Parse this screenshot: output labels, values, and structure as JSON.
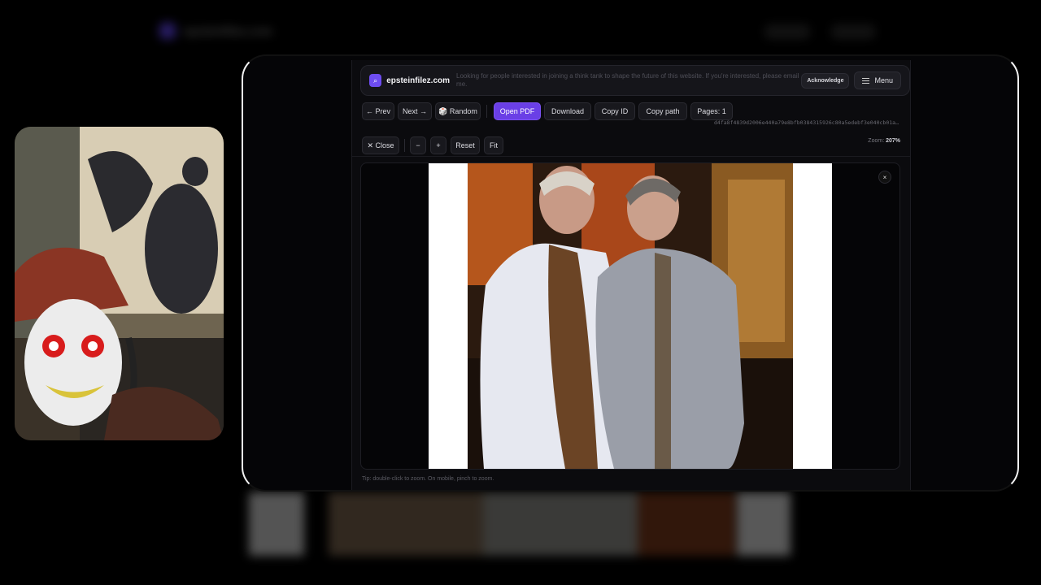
{
  "site": {
    "name": "epsteinfilez.com",
    "notice": "Looking for people interested in joining a think tank to shape the future of this website. If you're interested, please email me.",
    "acknowledge_label": "Acknowledge",
    "menu_label": "Menu",
    "accent": "#6a3fe6"
  },
  "toolbar": {
    "prev_label": "← Prev",
    "next_label": "Next →",
    "random_label": "🎲 Random",
    "open_pdf_label": "Open PDF",
    "download_label": "Download",
    "copy_id_label": "Copy ID",
    "copy_path_label": "Copy path",
    "pages_label": "Pages: 1",
    "doc_hash": "d4fa8f4839d2006e440a79e8bfb0384315926c80a5edebf3e040cb01a…"
  },
  "zoom_bar": {
    "close_label": "✕ Close",
    "zoom_out_label": "−",
    "zoom_in_label": "+",
    "reset_label": "Reset",
    "fit_label": "Fit",
    "zoom_prefix": "Zoom:",
    "zoom_value": "207%"
  },
  "viewer": {
    "close_icon": "×"
  },
  "tip": "Tip: double-click to zoom. On mobile, pinch to zoom."
}
